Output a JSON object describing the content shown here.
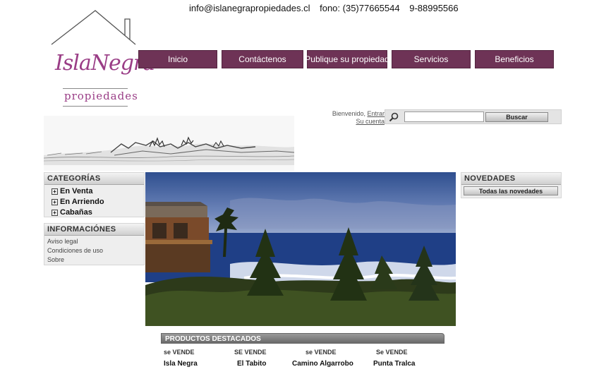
{
  "contact": {
    "email": "info@islanegrapropiedades.cl",
    "phone": "fono: (35)77665544",
    "mobile": "9-88995566"
  },
  "logo": {
    "name": "IslaNegra",
    "sub": "propiedades"
  },
  "nav": [
    "Inicio",
    "Contáctenos",
    "Publique su propiedad",
    "Servicios",
    "Beneficios"
  ],
  "account": {
    "welcome": "Bienvenido,",
    "login": "Entrar",
    "account": "Su cuenta"
  },
  "search": {
    "button": "Buscar",
    "value": ""
  },
  "categories": {
    "title": "CATEGORÍAS",
    "items": [
      "En Venta",
      "En Arriendo",
      "Cabañas"
    ]
  },
  "info": {
    "title": "INFORMACIÓNES",
    "items": [
      "Aviso legal",
      "Condiciones de uso",
      "Sobre"
    ]
  },
  "news": {
    "title": "NOVEDADES",
    "button": "Todas las novedades"
  },
  "featured": {
    "title": "PRODUCTOS DESTACADOS",
    "products": [
      {
        "tag": "se VENDE",
        "name": "Isla Negra"
      },
      {
        "tag": "SE VENDE",
        "name": "El Tabito"
      },
      {
        "tag": "se VENDE",
        "name": "Camino Algarrobo"
      },
      {
        "tag": "Se VENDE",
        "name": "Punta Tralca"
      }
    ]
  },
  "colors": {
    "nav": "#6e3356",
    "logo": "#9a3d86"
  }
}
